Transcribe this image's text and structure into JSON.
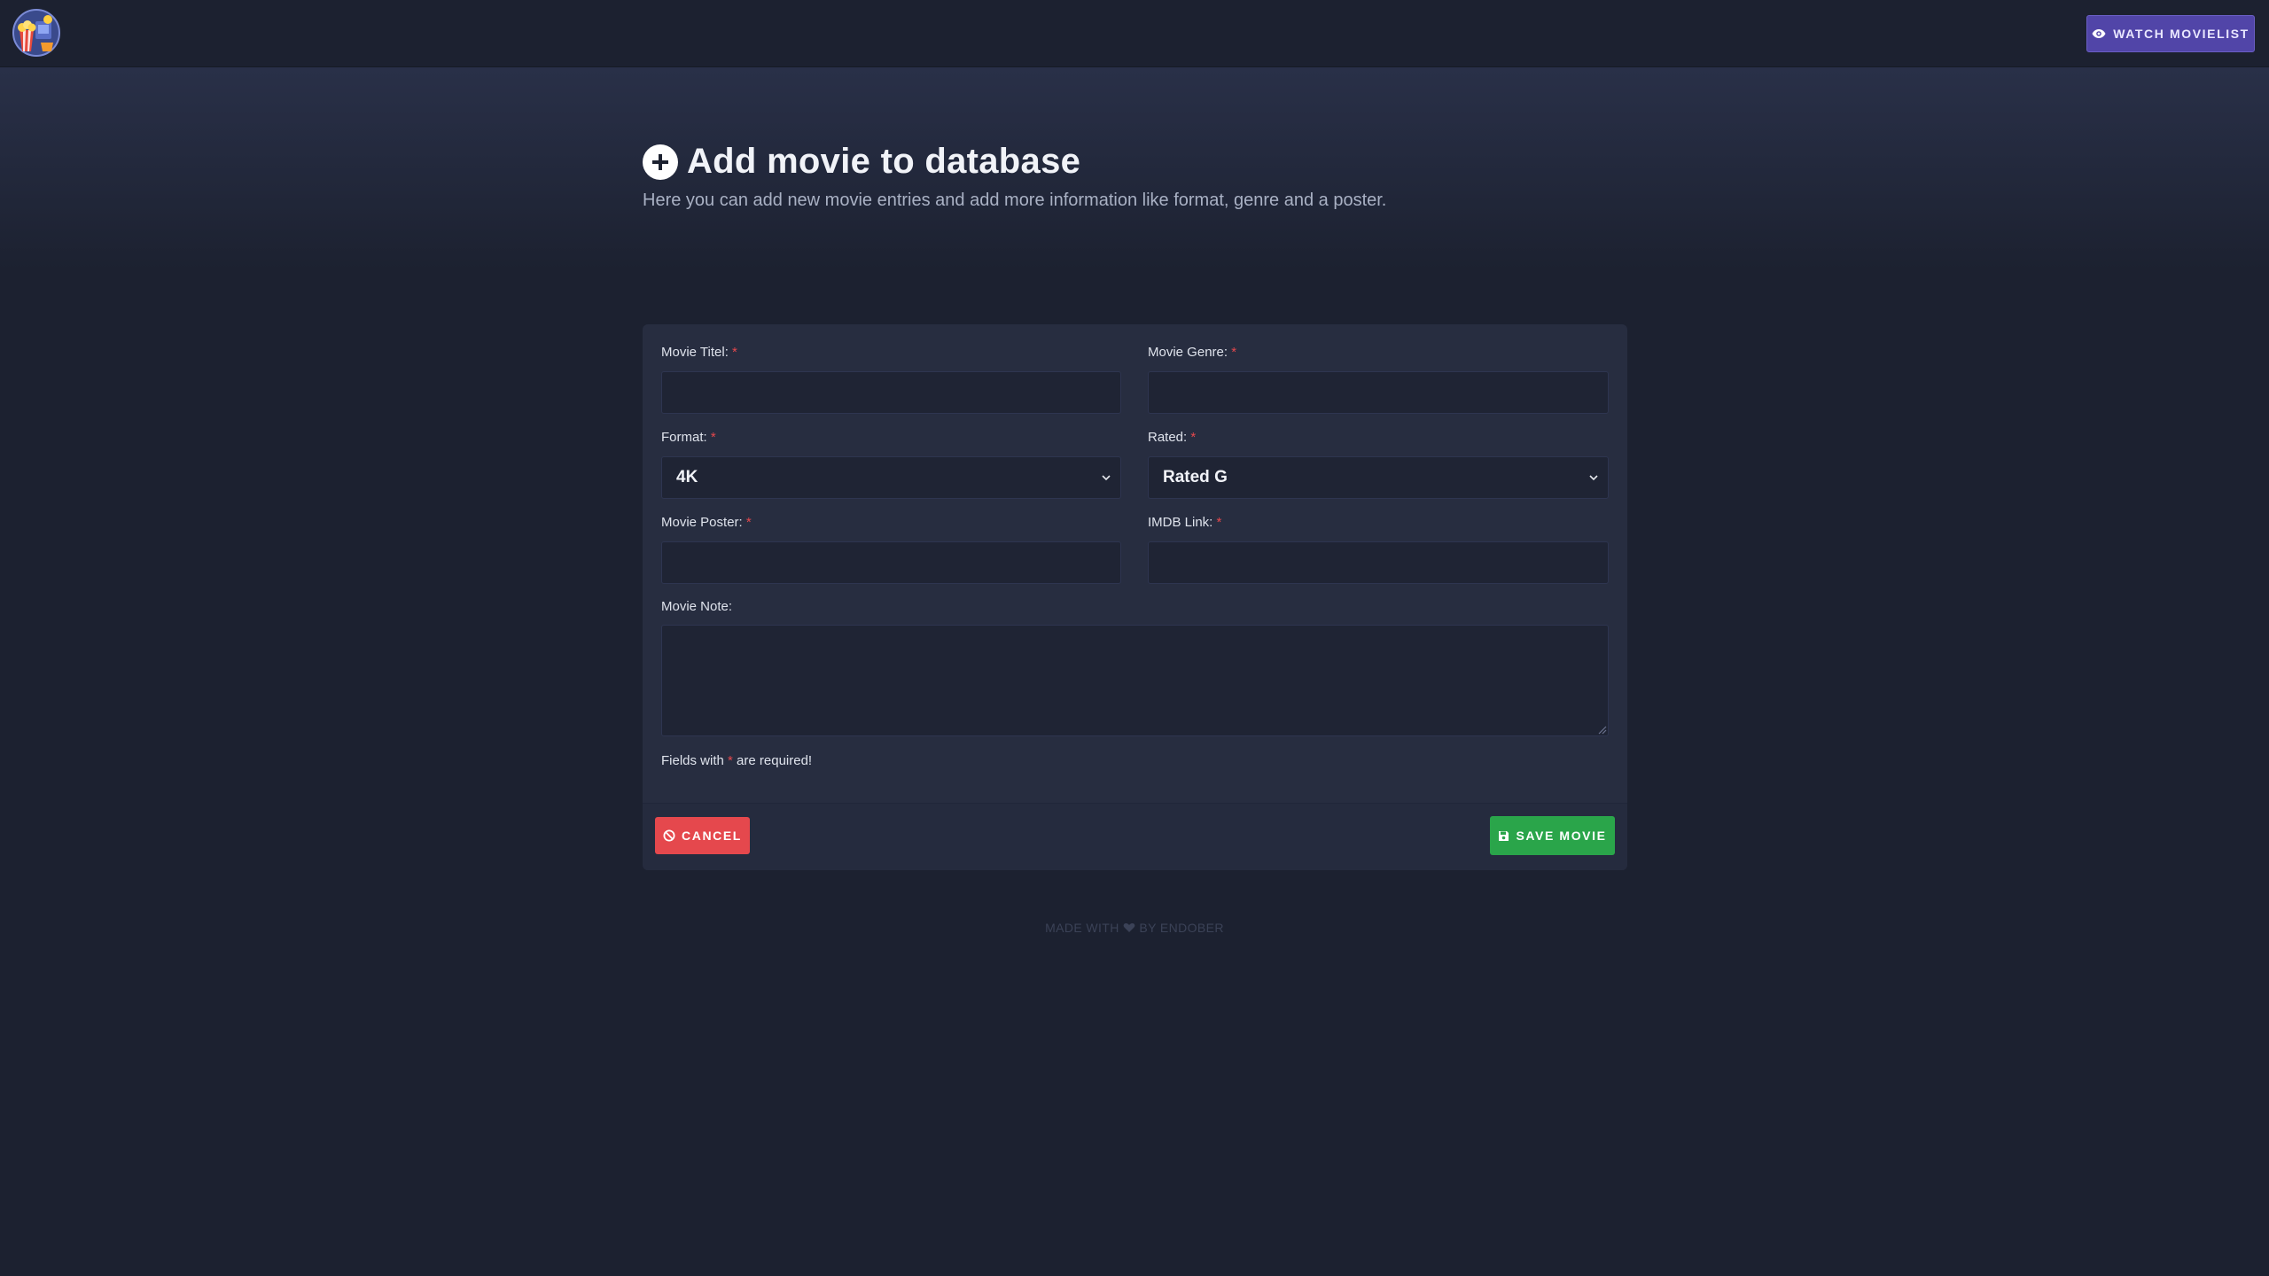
{
  "header": {
    "watch_button_label": "WATCH MOVIELIST"
  },
  "page": {
    "title": "Add movie to database",
    "subtitle": "Here you can add new movie entries and add more information like format, genre and a poster."
  },
  "form": {
    "movie_title": {
      "label": "Movie Titel:",
      "required_mark": "*",
      "value": ""
    },
    "movie_genre": {
      "label": "Movie Genre:",
      "required_mark": "*",
      "value": ""
    },
    "format": {
      "label": "Format:",
      "required_mark": "*",
      "selected": "4K"
    },
    "rated": {
      "label": "Rated:",
      "required_mark": "*",
      "selected": "Rated G"
    },
    "movie_poster": {
      "label": "Movie Poster:",
      "required_mark": "*",
      "value": ""
    },
    "imdb_link": {
      "label": "IMDB Link:",
      "required_mark": "*",
      "value": ""
    },
    "movie_note": {
      "label": "Movie Note:",
      "value": ""
    },
    "required_note": {
      "prefix": "Fields with ",
      "mark": "*",
      "suffix": " are required!"
    }
  },
  "actions": {
    "cancel_label": "CANCEL",
    "save_label": "SAVE MOVIE"
  },
  "footer": {
    "made_with": "MADE WITH",
    "by": "BY ENDOBER"
  },
  "colors": {
    "background": "#1c2130",
    "card": "#272d40",
    "accent_purple": "#5145a8",
    "cancel_red": "#e5484d",
    "save_green": "#2aa54a",
    "required_red": "#e5484d"
  },
  "icons": {
    "logo": "popcorn-clapper-logo",
    "watch": "eye-icon",
    "title": "plus-circle-icon",
    "cancel": "ban-icon",
    "save": "floppy-disk-icon",
    "select_arrow": "chevron-down-icon",
    "footer_heart": "heart-icon"
  }
}
